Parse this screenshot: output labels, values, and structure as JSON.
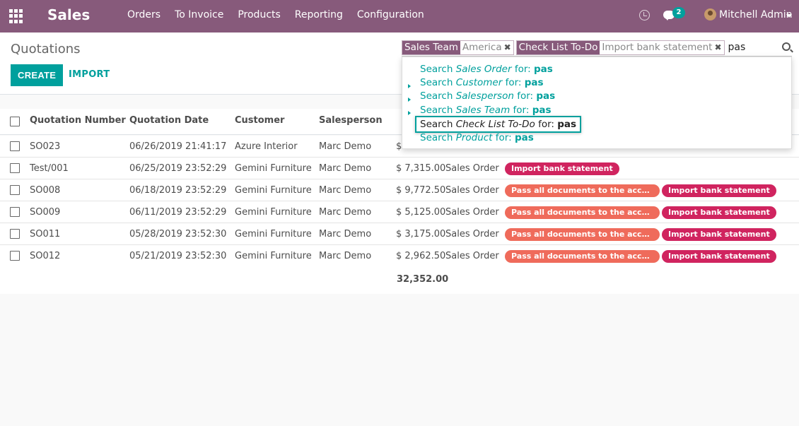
{
  "navbar": {
    "app_name": "Sales",
    "menu": [
      "Orders",
      "To Invoice",
      "Products",
      "Reporting",
      "Configuration"
    ],
    "chat_count": "2",
    "user": "Mitchell Admin",
    "color": "#875a7b"
  },
  "control_panel": {
    "breadcrumb": "Quotations",
    "create_label": "CREATE",
    "import_label": "IMPORT"
  },
  "search": {
    "facets": [
      {
        "label": "Sales Team",
        "value": "America"
      },
      {
        "label": "Check List To-Do",
        "value": "Import bank statement"
      }
    ],
    "query": "pas"
  },
  "autocomplete": {
    "prefix": "Search",
    "connector": "for:",
    "items": [
      {
        "field": "Sales Order",
        "term": "pas",
        "expandable": false,
        "focused": false
      },
      {
        "field": "Customer",
        "term": "pas",
        "expandable": true,
        "focused": false
      },
      {
        "field": "Salesperson",
        "term": "pas",
        "expandable": true,
        "focused": false
      },
      {
        "field": "Sales Team",
        "term": "pas",
        "expandable": true,
        "focused": false
      },
      {
        "field": "Check List To-Do",
        "term": "pas",
        "expandable": false,
        "focused": true
      },
      {
        "field": "Product",
        "term": "pas",
        "expandable": false,
        "focused": false
      }
    ]
  },
  "table": {
    "columns": [
      "Quotation Number",
      "Quotation Date",
      "Customer",
      "Salesperson"
    ],
    "rows": [
      {
        "number": "SO023",
        "date": "06/26/2019 21:41:17",
        "customer": "Azure Interior",
        "salesperson": "Marc Demo",
        "total": "$",
        "status": "",
        "tags": []
      },
      {
        "number": "Test/001",
        "date": "06/25/2019 23:52:29",
        "customer": "Gemini Furniture",
        "salesperson": "Marc Demo",
        "total": "$ 7,315.00",
        "status": "Sales Order",
        "tags": [
          "Import bank statement"
        ]
      },
      {
        "number": "SO008",
        "date": "06/18/2019 23:52:29",
        "customer": "Gemini Furniture",
        "salesperson": "Marc Demo",
        "total": "$ 9,772.50",
        "status": "Sales Order",
        "tags": [
          "Pass all documents to the account...",
          "Import bank statement"
        ]
      },
      {
        "number": "SO009",
        "date": "06/11/2019 23:52:29",
        "customer": "Gemini Furniture",
        "salesperson": "Marc Demo",
        "total": "$ 5,125.00",
        "status": "Sales Order",
        "tags": [
          "Pass all documents to the account...",
          "Import bank statement"
        ]
      },
      {
        "number": "SO011",
        "date": "05/28/2019 23:52:30",
        "customer": "Gemini Furniture",
        "salesperson": "Marc Demo",
        "total": "$ 3,175.00",
        "status": "Sales Order",
        "tags": [
          "Pass all documents to the account...",
          "Import bank statement"
        ]
      },
      {
        "number": "SO012",
        "date": "05/21/2019 23:52:30",
        "customer": "Gemini Furniture",
        "salesperson": "Marc Demo",
        "total": "$ 2,962.50",
        "status": "Sales Order",
        "tags": [
          "Pass all documents to the account...",
          "Import bank statement"
        ]
      }
    ],
    "grand_total": "32,352.00"
  },
  "colors": {
    "brand": "#875a7b",
    "accent": "#00a09d",
    "tag_orange": "#ef6b5b",
    "tag_red": "#d0245f"
  }
}
